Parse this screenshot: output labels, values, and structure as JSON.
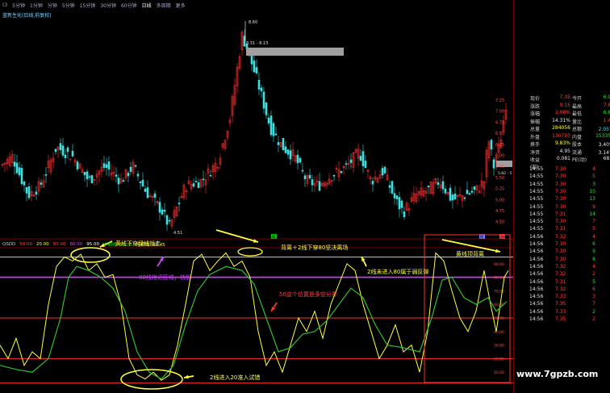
{
  "toolbar": {
    "items": [
      "(3",
      "5分钟",
      "1分钟",
      "分钟",
      "5分钟",
      "15分钟",
      "30分钟",
      "60分钟",
      "日线",
      "多周期",
      "更多"
    ],
    "active_index": 8
  },
  "main_chart": {
    "title": "蓝新生化(日线,前复权)",
    "high_label": "8.60",
    "high_range_label": "8.31 - 8.13",
    "low_label": "4.51",
    "right_price_label": "5.82 - 5",
    "price_axis": [
      "7.25",
      "7.00",
      "6.75",
      "6.50",
      "6.25",
      "6.00",
      "5.75",
      "5.50",
      "5.25",
      "5.00",
      "4.75",
      "4.50"
    ],
    "markers": [
      {
        "text": "图",
        "color": "#00c000"
      },
      {
        "text": "图",
        "color": "#6080ff"
      },
      {
        "text": "退市",
        "color": "#ff4040"
      }
    ]
  },
  "indicator": {
    "header": [
      {
        "text": "QSDD",
        "color": "#d0d0d0"
      },
      {
        "text": "50.00",
        "color": "#ff4040"
      },
      {
        "text": "20.00",
        "color": "#ffff40"
      },
      {
        "text": "80.00",
        "color": "#ff4040"
      },
      {
        "text": "80.00",
        "color": "#d040ff"
      },
      {
        "text": "95.00",
        "color": "#ffffff"
      },
      {
        "text": "中期线: 65.75",
        "color": "#30e030"
      },
      {
        "text": "短期线: 80.45",
        "color": "#ffff40"
      }
    ],
    "axis": [
      "90.00",
      "80.00",
      "70.00",
      "60.00",
      "50.00",
      "40.00",
      "30.00",
      "20.00",
      "10.00"
    ],
    "annotations": [
      {
        "text": "黄线下穿绿线就走",
        "color": "#ffff40"
      },
      {
        "text": "80线附近区域，持股",
        "color": "#d040ff"
      },
      {
        "text": "背离＋2线下穿80坚决离场",
        "color": "#ffff40"
      },
      {
        "text": "50这个位置是多空分界",
        "color": "#ff4040"
      },
      {
        "text": "2线未进入80属于弱反弹",
        "color": "#ffff40"
      },
      {
        "text": "黄线顶背离",
        "color": "#ffff40"
      },
      {
        "text": "2线进入20准入试错",
        "color": "#ffff40"
      }
    ]
  },
  "quote_panel": {
    "rows": [
      {
        "l": "现价",
        "v": "7.35",
        "l2": "今开",
        "v2": "6.98",
        "vc": "red",
        "v2c": "green"
      },
      {
        "l": "涨跌",
        "v": "0.15",
        "l2": "最高",
        "v2": "7.87",
        "vc": "red",
        "v2c": "red"
      },
      {
        "l": "涨幅",
        "v": "2.08%",
        "l2": "最低",
        "v2": "6.85",
        "vc": "red",
        "v2c": "green"
      },
      {
        "l": "振幅",
        "v": "14.31%",
        "l2": "量比",
        "v2": "1.44",
        "vc": "white",
        "v2c": "red"
      },
      {
        "l": "总量",
        "v": "284056",
        "l2": "总额",
        "v2": "2.05亿",
        "vc": "yellow",
        "v2c": "cyan"
      },
      {
        "l": "外盘",
        "v": "130703",
        "l2": "内盘",
        "v2": "153353",
        "vc": "red",
        "v2c": "green"
      },
      {
        "l": "换手",
        "v": "9.83%",
        "l2": "股本",
        "v2": "3.40亿",
        "vc": "yellow",
        "v2c": "white"
      },
      {
        "l": "净资",
        "v": "4.95",
        "l2": "流通",
        "v2": "3.14亿",
        "vc": "white",
        "v2c": "white"
      },
      {
        "l": "收益(四)",
        "v": "0.081",
        "l2": "PE(动)",
        "v2": "68.0",
        "vc": "white",
        "v2c": "white"
      }
    ],
    "ticks": [
      {
        "t": "14:55",
        "p": "7.30",
        "v": "4",
        "vc": "red"
      },
      {
        "t": "14:55",
        "p": "7.30",
        "v": "5",
        "vc": "red"
      },
      {
        "t": "14:55",
        "p": "7.30",
        "v": "3",
        "vc": "green"
      },
      {
        "t": "14:55",
        "p": "7.30",
        "v": "10",
        "vc": "green"
      },
      {
        "t": "14:55",
        "p": "7.30",
        "v": "13",
        "vc": "green"
      },
      {
        "t": "14:55",
        "p": "7.30",
        "v": "9",
        "vc": "red"
      },
      {
        "t": "14:55",
        "p": "7.31",
        "v": "14",
        "vc": "green"
      },
      {
        "t": "14:55",
        "p": "7.30",
        "v": "7",
        "vc": "red"
      },
      {
        "t": "14:55",
        "p": "7.31",
        "v": "5",
        "vc": "red"
      },
      {
        "t": "14:56",
        "p": "7.32",
        "v": "4",
        "vc": "red"
      },
      {
        "t": "14:56",
        "p": "7.30",
        "v": "6",
        "vc": "green"
      },
      {
        "t": "14:56",
        "p": "7.30",
        "v": "9",
        "vc": "green"
      },
      {
        "t": "14:56",
        "p": "7.30",
        "v": "8",
        "vc": "green"
      },
      {
        "t": "14:56",
        "p": "7.32",
        "v": "4",
        "vc": "red"
      },
      {
        "t": "14:56",
        "p": "7.32",
        "v": "2",
        "vc": "red"
      },
      {
        "t": "14:56",
        "p": "7.31",
        "v": "5",
        "vc": "green"
      },
      {
        "t": "14:56",
        "p": "7.32",
        "v": "6",
        "vc": "red"
      },
      {
        "t": "14:56",
        "p": "7.33",
        "v": "3",
        "vc": "red"
      },
      {
        "t": "14:56",
        "p": "7.35",
        "v": "7",
        "vc": "red"
      },
      {
        "t": "14:56",
        "p": "7.33",
        "v": "2",
        "vc": "green"
      },
      {
        "t": "14:56",
        "p": "7.35",
        "v": "2",
        "vc": "red"
      }
    ]
  },
  "watermark": "www.7gpzb.com"
}
